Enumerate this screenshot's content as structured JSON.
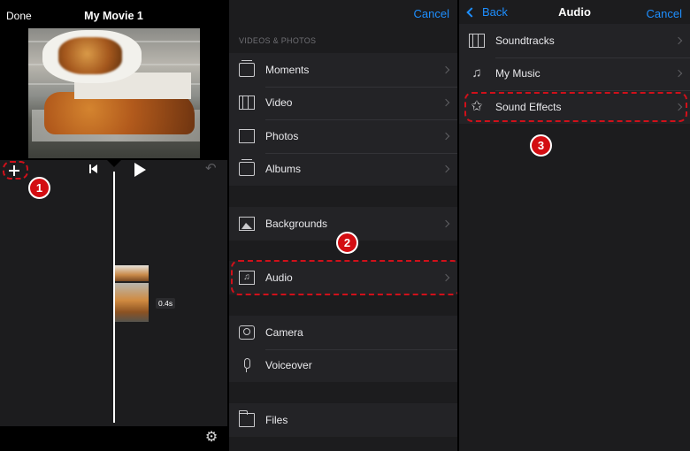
{
  "panel1": {
    "done_label": "Done",
    "title": "My Movie 1",
    "clip_duration": "0.4s",
    "step_badge": "1"
  },
  "panel2": {
    "cancel_label": "Cancel",
    "section_header": "VIDEOS & PHOTOS",
    "media_items": [
      {
        "label": "Moments",
        "icon": "moments-icon"
      },
      {
        "label": "Video",
        "icon": "film-icon"
      },
      {
        "label": "Photos",
        "icon": "photo-icon"
      },
      {
        "label": "Albums",
        "icon": "album-icon"
      }
    ],
    "backgrounds_label": "Backgrounds",
    "audio_label": "Audio",
    "camera_label": "Camera",
    "voiceover_label": "Voiceover",
    "files_label": "Files",
    "step_badge": "2"
  },
  "panel3": {
    "back_label": "Back",
    "title": "Audio",
    "cancel_label": "Cancel",
    "items": [
      {
        "label": "Soundtracks",
        "icon": "film-icon"
      },
      {
        "label": "My Music",
        "icon": "music-note-icon"
      },
      {
        "label": "Sound Effects",
        "icon": "star-burst-icon"
      }
    ],
    "step_badge": "3"
  },
  "colors": {
    "accent": "#1e8fff",
    "highlight": "#d0101a",
    "background": "#1c1c1e"
  }
}
